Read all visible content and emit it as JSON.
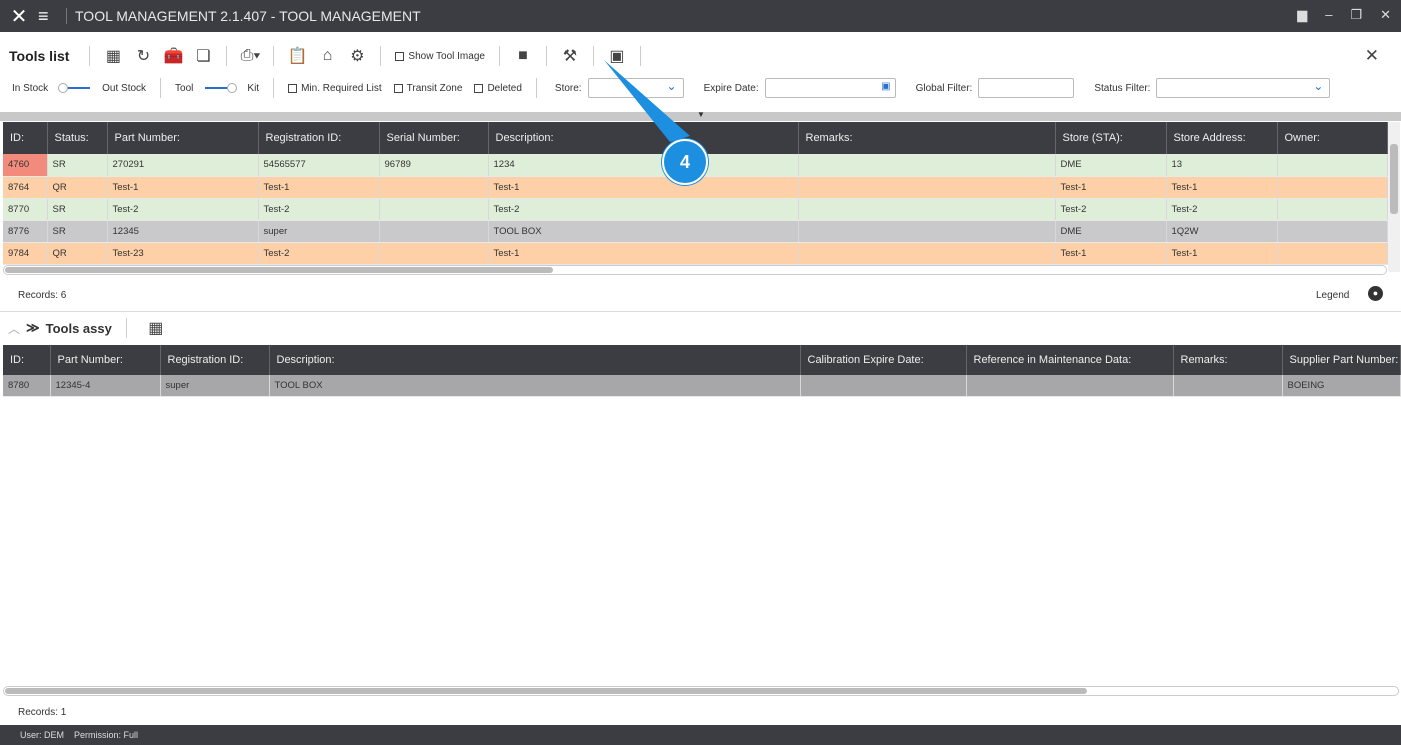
{
  "titlebar": {
    "title": "TOOL MANAGEMENT 2.1.407 - TOOL MANAGEMENT"
  },
  "toolbar": {
    "title": "Tools list",
    "show_tool_image": "Show Tool Image"
  },
  "filters": {
    "in_stock": "In Stock",
    "out_stock": "Out Stock",
    "tool": "Tool",
    "kit": "Kit",
    "min_required": "Min. Required List",
    "transit_zone": "Transit Zone",
    "deleted": "Deleted",
    "store": "Store:",
    "expire_date": "Expire Date:",
    "global_filter": "Global Filter:",
    "status_filter": "Status Filter:"
  },
  "callout": "4",
  "tools": {
    "columns": [
      "ID:",
      "Status:",
      "Part Number:",
      "Registration ID:",
      "Serial Number:",
      "Description:",
      "Remarks:",
      "Store (STA):",
      "Store Address:",
      "Owner:"
    ],
    "rows": [
      [
        "4760",
        "SR",
        "270291",
        "54565577",
        "96789",
        "1234",
        "",
        "DME",
        "13",
        ""
      ],
      [
        "8764",
        "QR",
        "Test-1",
        "Test-1",
        "",
        "Test-1",
        "",
        "Test-1",
        "Test-1",
        ""
      ],
      [
        "8770",
        "SR",
        "Test-2",
        "Test-2",
        "",
        "Test-2",
        "",
        "Test-2",
        "Test-2",
        ""
      ],
      [
        "8776",
        "SR",
        "12345",
        "super",
        "",
        "TOOL BOX",
        "",
        "DME",
        "1Q2W",
        ""
      ],
      [
        "9784",
        "QR",
        "Test-23",
        "Test-2",
        "",
        "Test-1",
        "",
        "Test-1",
        "Test-1",
        ""
      ]
    ],
    "row_colors": [
      "#dfeed9",
      "#fdd0a8",
      "#dfeed9",
      "#c9c9cb",
      "#fdd0a8"
    ],
    "records": "Records: 6",
    "legend": "Legend"
  },
  "assy": {
    "title": "Tools assy",
    "columns": [
      "ID:",
      "Part Number:",
      "Registration ID:",
      "Description:",
      "Calibration Expire Date:",
      "Reference in Maintenance Data:",
      "Remarks:",
      "Supplier Part Number:"
    ],
    "rows": [
      [
        "8780",
        "12345-4",
        "super",
        "TOOL BOX",
        "",
        "",
        "",
        "BOEING"
      ]
    ],
    "records": "Records: 1"
  },
  "footer": {
    "user": "User: DEM",
    "permission": "Permission: Full"
  }
}
